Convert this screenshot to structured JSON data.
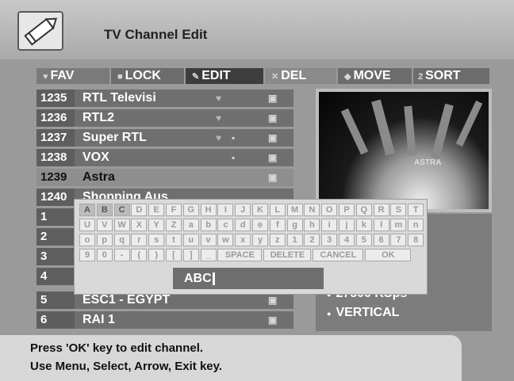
{
  "header": {
    "title": "TV Channel Edit",
    "icon": "pencil-icon"
  },
  "function_bar": {
    "fav": "FAV",
    "lock": "LOCK",
    "edit": "EDIT",
    "del": "DEL",
    "move": "MOVE",
    "sort": "SORT",
    "sort_key": "2"
  },
  "channels": [
    {
      "num": "1235",
      "name": "RTL Televisi"
    },
    {
      "num": "1236",
      "name": "RTL2"
    },
    {
      "num": "1237",
      "name": "Super RTL"
    },
    {
      "num": "1238",
      "name": "VOX"
    },
    {
      "num": "1239",
      "name": "Astra"
    },
    {
      "num": "1240",
      "name": "Shopping Aus"
    },
    {
      "num": "1",
      "name": ""
    },
    {
      "num": "2",
      "name": ""
    },
    {
      "num": "3",
      "name": ""
    },
    {
      "num": "4",
      "name": ""
    },
    {
      "num": "5",
      "name": "ESC1 - EGYPT"
    },
    {
      "num": "6",
      "name": "RAI 1"
    }
  ],
  "preview": {
    "caption": "ASTRA"
  },
  "info": {
    "symbol_rate": "27500 KSps",
    "polarization": "VERTICAL"
  },
  "keyboard": {
    "row1": [
      "A",
      "B",
      "C",
      "D",
      "E",
      "F",
      "G",
      "H",
      "I",
      "J",
      "K",
      "L",
      "M",
      "N",
      "O",
      "P",
      "Q",
      "R",
      "S",
      "T"
    ],
    "row2": [
      "U",
      "V",
      "W",
      "X",
      "Y",
      "Z",
      "a",
      "b",
      "c",
      "d",
      "e",
      "f",
      "g",
      "h",
      "i",
      "j",
      "k",
      "l",
      "m",
      "n"
    ],
    "row3": [
      "o",
      "p",
      "q",
      "r",
      "s",
      "t",
      "u",
      "v",
      "w",
      "x",
      "y",
      "z",
      "1",
      "2",
      "3",
      "4",
      "5",
      "6",
      "7",
      "8"
    ],
    "row4": [
      "9",
      "0",
      "-",
      "(",
      ")",
      "[",
      "]",
      "_"
    ],
    "space": "SPACE",
    "delete": "DELETE",
    "cancel": "CANCEL",
    "ok": "OK",
    "input_value": "ABC"
  },
  "footer": {
    "line1": "Press 'OK' key to edit channel.",
    "line2": "Use Menu, Select, Arrow, Exit key."
  }
}
